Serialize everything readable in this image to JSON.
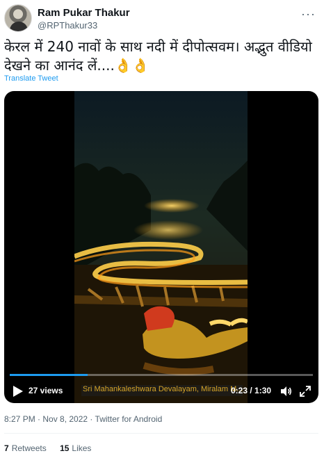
{
  "author": {
    "name": "Ram Pukar Thakur",
    "handle": "@RPThakur33",
    "more_menu": "···"
  },
  "tweet": {
    "text": "केरल में 240 नावों के साथ नदी में दीपोत्सवम।  अद्भुत वीडियो देखने का आनंद लें....👌👌",
    "translate_label": "Translate Tweet"
  },
  "video": {
    "views": "27 views",
    "time": "0:23 / 1:30",
    "caption": "Sri Mahankaleshwara Devalayam, Miralam M...",
    "progress": 0.256
  },
  "meta": {
    "timestamp": "8:27 PM · Nov 8, 2022",
    "separator": " · ",
    "client": "Twitter for Android"
  },
  "stats": {
    "retweets_count": "7",
    "retweets_label": "Retweets",
    "likes_count": "15",
    "likes_label": "Likes"
  },
  "colors": {
    "link": "#1d9bf0",
    "secondary_text": "#536471",
    "caption_text": "#d7a629"
  },
  "icons": [
    "avatar",
    "more-icon",
    "play-icon",
    "volume-icon",
    "fullscreen-icon"
  ]
}
